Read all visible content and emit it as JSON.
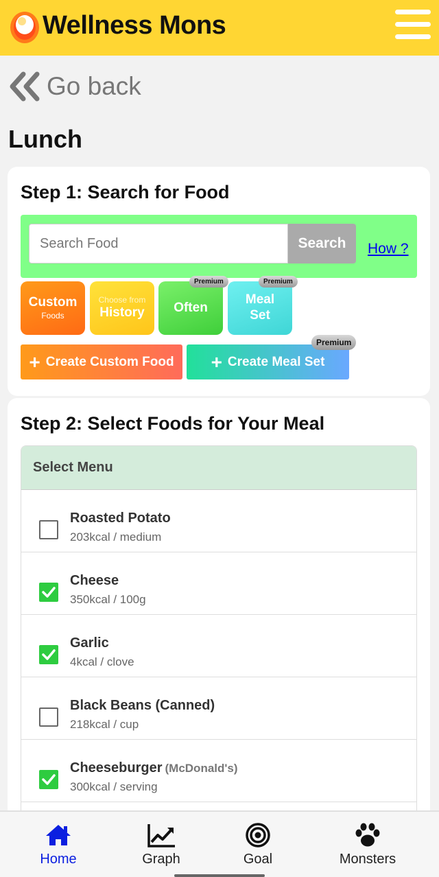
{
  "header": {
    "app_title": "Wellness Mons",
    "logo_icon": "wellness-mons-logo",
    "menu_icon": "hamburger-menu-icon",
    "bg_color": "#ffd633"
  },
  "nav_back": {
    "label": "Go back",
    "icon": "double-chevron-left-icon"
  },
  "page_title": "Lunch",
  "step1": {
    "title": "Step 1: Search for Food",
    "search_placeholder": "Search Food",
    "search_button": "Search",
    "how_link": "How ?",
    "tiles": [
      {
        "big": "Custom",
        "small": "Foods",
        "premium": false
      },
      {
        "small": "Choose from",
        "big": "History",
        "premium": false
      },
      {
        "big": "Often",
        "premium": true
      },
      {
        "big": "Meal Set",
        "premium": true
      }
    ],
    "premium_label": "Premium",
    "create_custom_food": "Create Custom Food",
    "create_meal_set": "Create Meal Set"
  },
  "step2": {
    "title": "Step 2: Select Foods for Your Meal",
    "menu_header": "Select Menu",
    "foods": [
      {
        "name": "Roasted Potato",
        "info": "203kcal / medium",
        "checked": false
      },
      {
        "name": "Cheese",
        "info": "350kcal / 100g",
        "checked": true
      },
      {
        "name": "Garlic",
        "info": "4kcal / clove",
        "checked": true
      },
      {
        "name": "Black Beans (Canned)",
        "info": "218kcal / cup",
        "checked": false
      },
      {
        "name": "Cheeseburger",
        "brand": "(McDonald's)",
        "info": "300kcal / serving",
        "checked": true
      }
    ]
  },
  "bottom_nav": {
    "items": [
      {
        "label": "Home",
        "icon": "home-icon",
        "active": true
      },
      {
        "label": "Graph",
        "icon": "chart-line-icon",
        "active": false
      },
      {
        "label": "Goal",
        "icon": "target-icon",
        "active": false
      },
      {
        "label": "Monsters",
        "icon": "paw-icon",
        "active": false
      }
    ],
    "active_color": "#0b1fe0"
  }
}
